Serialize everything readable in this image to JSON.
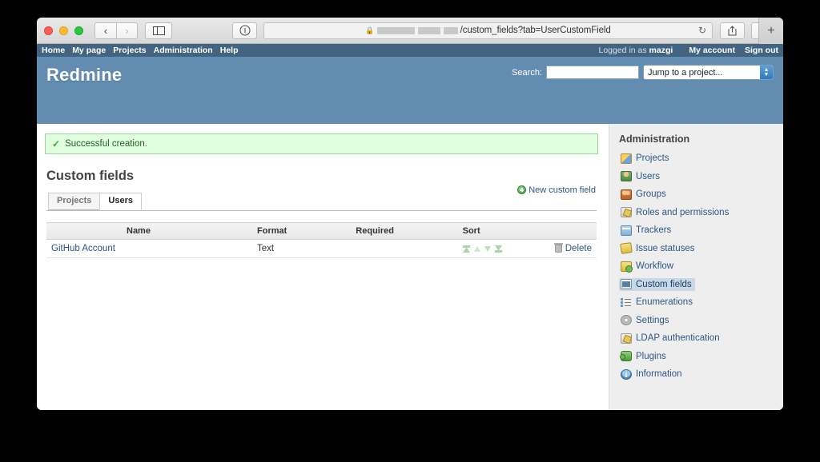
{
  "browser": {
    "url_text": "/custom_fields?tab=UserCustomField",
    "url_redacted": true,
    "lock_icon": "lock-icon",
    "reload_icon": "reload-icon",
    "back_icon": "back-arrow-icon",
    "forward_icon": "forward-arrow-icon",
    "sidebar_icon": "sidebar-toggle-icon",
    "reader_icon": "reader-info-icon",
    "share_icon": "share-icon",
    "tabs_icon": "show-tabs-icon",
    "newtab_label": "+"
  },
  "topmenu": {
    "items": [
      {
        "label": "Home"
      },
      {
        "label": "My page"
      },
      {
        "label": "Projects"
      },
      {
        "label": "Administration"
      },
      {
        "label": "Help"
      }
    ],
    "logged_in_prefix": "Logged in as",
    "logged_in_user": "mazgi",
    "account_label": "My account",
    "signout_label": "Sign out"
  },
  "header": {
    "logo": "Redmine",
    "search_label": "Search:",
    "search_value": "",
    "project_select_value": "Jump to a project..."
  },
  "flash": {
    "message": "Successful creation.",
    "icon": "check-icon"
  },
  "main": {
    "page_title": "Custom fields",
    "new_field_label": "New custom field",
    "tabs": [
      {
        "label": "Projects",
        "selected": false
      },
      {
        "label": "Users",
        "selected": true
      }
    ],
    "table": {
      "columns": [
        "Name",
        "Format",
        "Required",
        "Sort"
      ],
      "rows": [
        {
          "name": "GitHub Account",
          "format": "Text",
          "required": "",
          "sort_icons": [
            "sort-to-top-icon",
            "sort-up-icon",
            "sort-down-icon",
            "sort-to-bottom-icon"
          ],
          "delete_label": "Delete",
          "delete_icon": "trash-icon"
        }
      ]
    }
  },
  "sidebar": {
    "title": "Administration",
    "items": [
      {
        "label": "Projects",
        "icon": "projects-icon",
        "selected": false
      },
      {
        "label": "Users",
        "icon": "users-icon",
        "selected": false
      },
      {
        "label": "Groups",
        "icon": "groups-icon",
        "selected": false
      },
      {
        "label": "Roles and permissions",
        "icon": "roles-icon",
        "selected": false
      },
      {
        "label": "Trackers",
        "icon": "trackers-icon",
        "selected": false
      },
      {
        "label": "Issue statuses",
        "icon": "issue-statuses-icon",
        "selected": false
      },
      {
        "label": "Workflow",
        "icon": "workflow-icon",
        "selected": false
      },
      {
        "label": "Custom fields",
        "icon": "custom-fields-icon",
        "selected": true
      },
      {
        "label": "Enumerations",
        "icon": "enumerations-icon",
        "selected": false
      },
      {
        "label": "Settings",
        "icon": "settings-gear-icon",
        "selected": false
      },
      {
        "label": "LDAP authentication",
        "icon": "ldap-icon",
        "selected": false
      },
      {
        "label": "Plugins",
        "icon": "plugins-icon",
        "selected": false
      },
      {
        "label": "Information",
        "icon": "information-icon",
        "selected": false
      }
    ]
  },
  "colors": {
    "header_blue": "#628db0",
    "topmenu_blue": "#436480",
    "link_blue": "#2a5685",
    "flash_bg": "#dfffdf",
    "flash_border": "#9fcf9f",
    "sidebar_bg": "#eeeeee",
    "selected_item_bg": "#c8d8e6"
  }
}
